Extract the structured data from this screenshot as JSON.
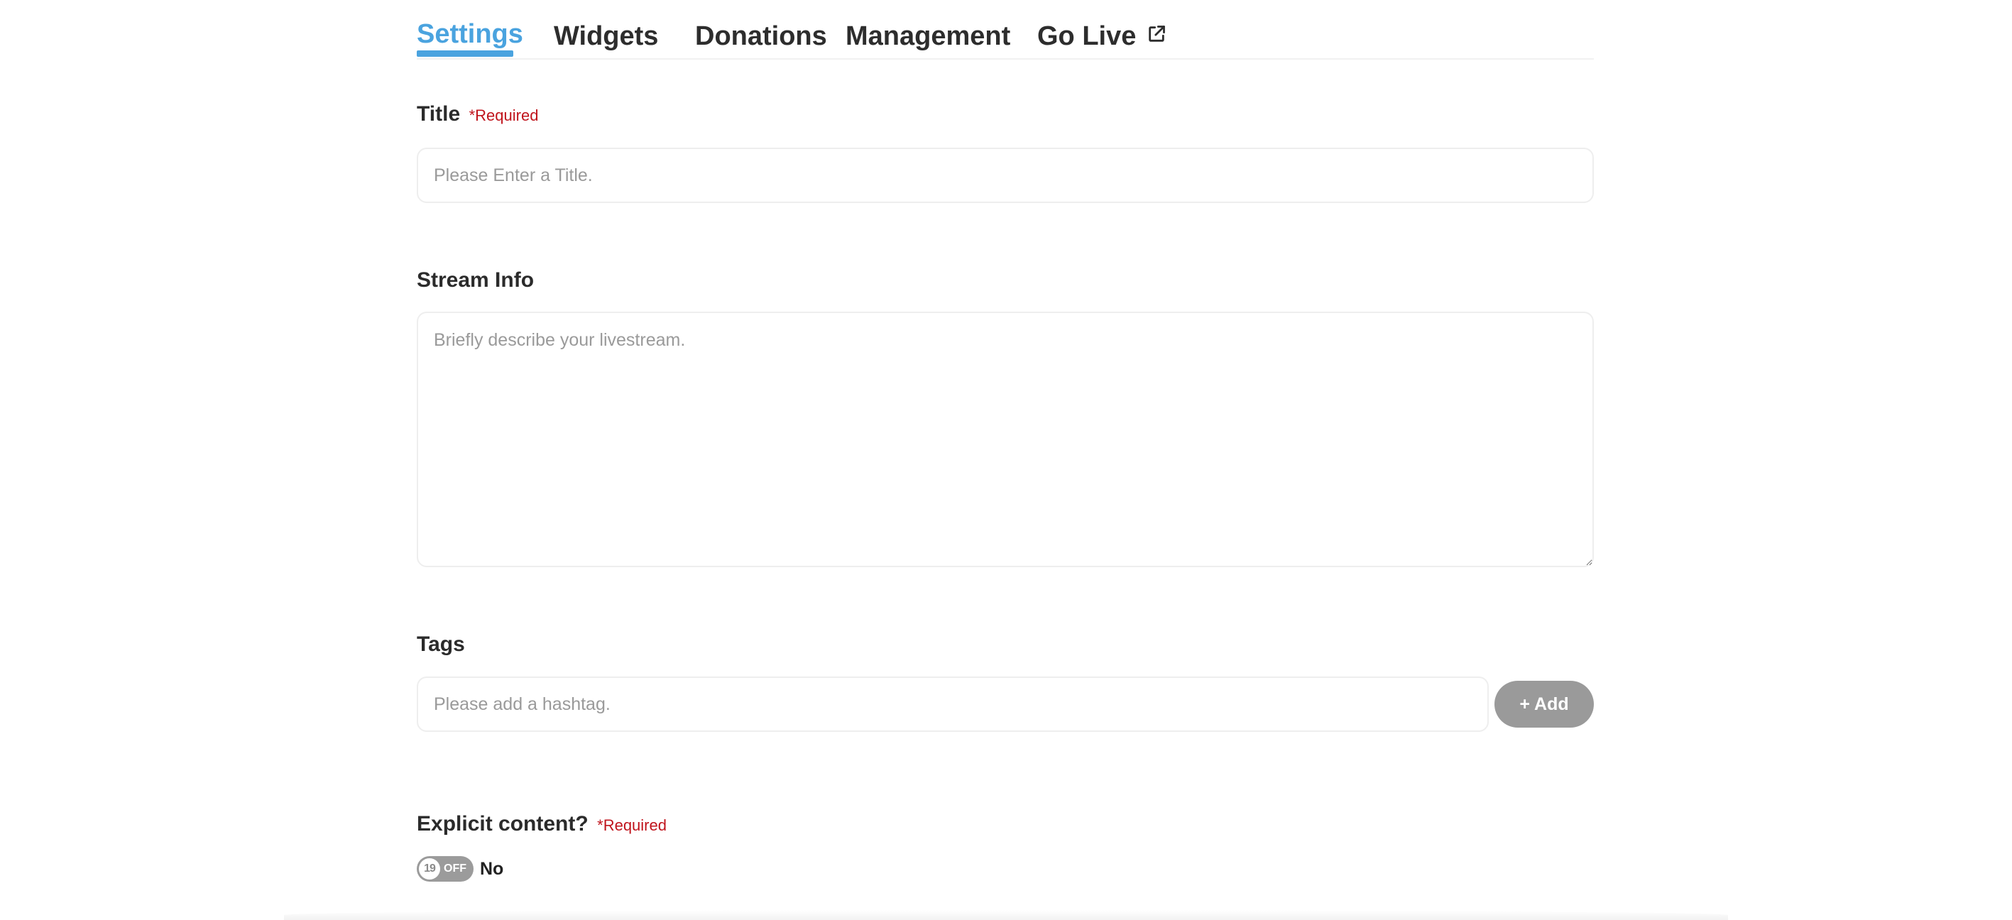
{
  "tabs": [
    {
      "label": "Settings",
      "active": true
    },
    {
      "label": "Widgets",
      "active": false
    },
    {
      "label": "Donations",
      "active": false
    },
    {
      "label": "Management",
      "active": false
    },
    {
      "label": "Go Live",
      "active": false,
      "icon": "external-link-icon"
    }
  ],
  "accent_color": "#4aa3df",
  "required_color": "#c0141c",
  "form": {
    "title": {
      "label": "Title",
      "required": "*Required",
      "value": "",
      "placeholder": "Please Enter a Title."
    },
    "stream_info": {
      "label": "Stream Info",
      "value": "",
      "placeholder": "Briefly describe your livestream."
    },
    "tags": {
      "label": "Tags",
      "value": "",
      "placeholder": "Please add a hashtag.",
      "add_label": "+ Add"
    },
    "explicit": {
      "label": "Explicit content?",
      "required": "*Required",
      "badge": "19",
      "toggle_text": "OFF",
      "value_text": "No"
    }
  }
}
